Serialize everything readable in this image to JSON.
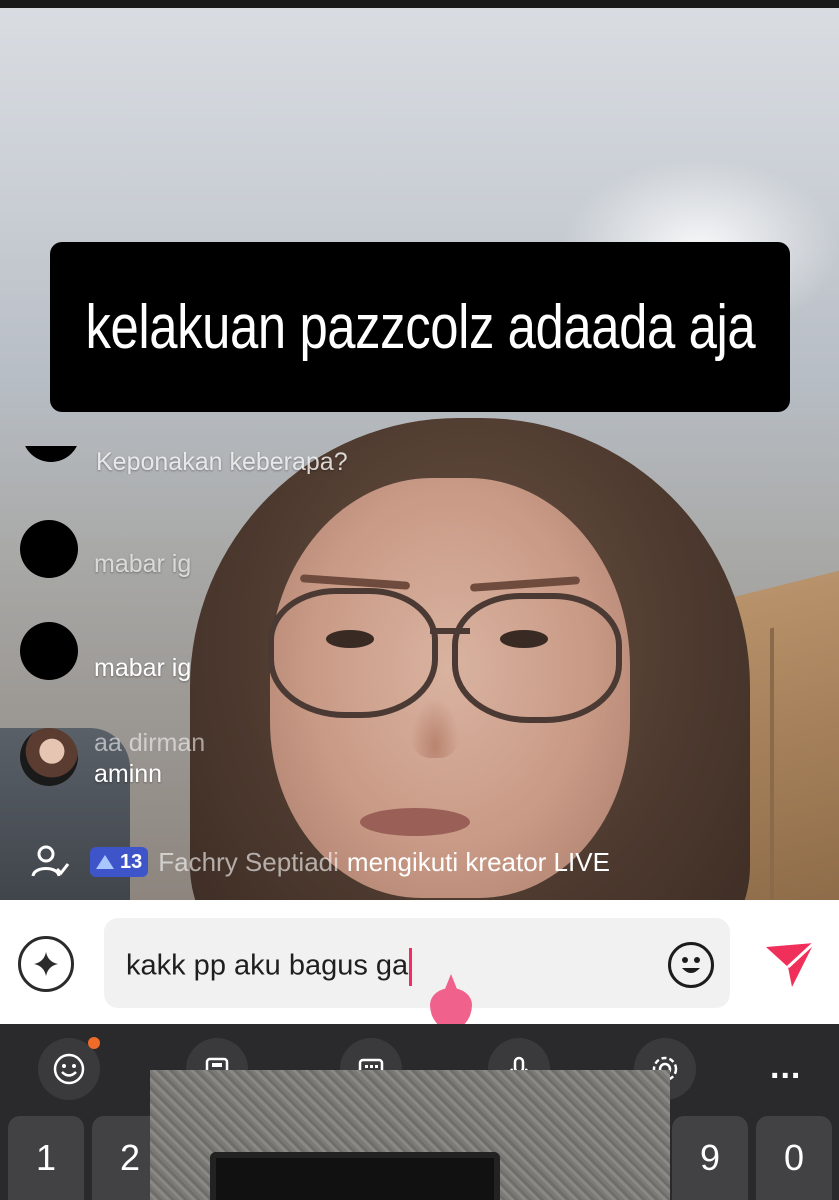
{
  "caption": {
    "text": "kelakuan pazzcolz adaada aja"
  },
  "comments": [
    {
      "user": "",
      "message": "Keponakan keberapa?"
    },
    {
      "user": "",
      "message": "mabar ig"
    },
    {
      "user": "",
      "message": "mabar ig"
    },
    {
      "user": "aa dirman",
      "message": "aminn"
    }
  ],
  "system_message": {
    "badge_level": "13",
    "name": "Fachry Septiadi",
    "text": "mengikuti kreator LIVE"
  },
  "input": {
    "value": "kakk pp aku bagus ga"
  },
  "keyboard": {
    "toolbar_icons": [
      "emoji-icon",
      "clipboard-icon",
      "keyboard-icon",
      "microphone-icon",
      "settings-icon"
    ],
    "more_label": "...",
    "number_keys": [
      "1",
      "2",
      "9",
      "0"
    ]
  },
  "colors": {
    "caption_bg": "#000000",
    "send": "#f0305a",
    "badge": "#3d55c9",
    "keyboard_bg": "#2a2a2c"
  }
}
